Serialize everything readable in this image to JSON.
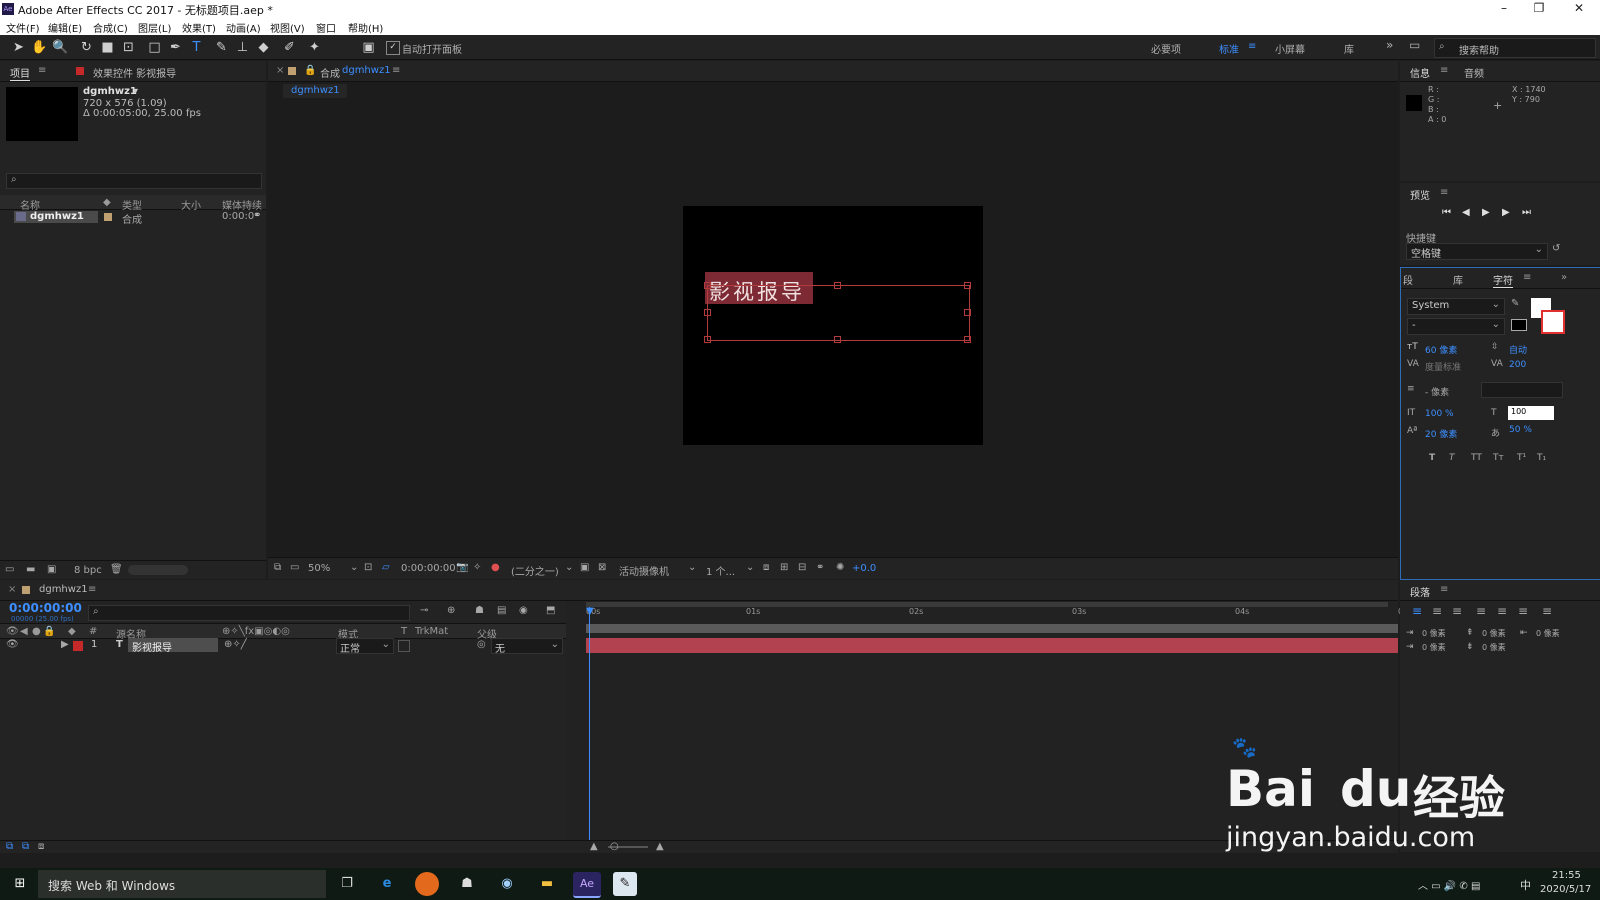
{
  "window": {
    "title": "Adobe After Effects CC 2017 - 无标题项目.aep *"
  },
  "menu": [
    "文件(F)",
    "编辑(E)",
    "合成(C)",
    "图层(L)",
    "效果(T)",
    "动画(A)",
    "视图(V)",
    "窗口",
    "帮助(H)"
  ],
  "toolbar": {
    "auto_open": "自动打开面板",
    "workspaces": [
      "必要项",
      "标准",
      "小屏幕",
      "库"
    ],
    "search_placeholder": "搜索帮助"
  },
  "project": {
    "tab": "项目",
    "effects_tab": "效果控件 影视报导",
    "item_name": "dgmhwz1",
    "item_size": "720 x 576 (1.09)",
    "item_duration": "Δ 0:00:05:00, 25.00 fps",
    "columns": [
      "名称",
      "类型",
      "大小",
      "媒体持续"
    ],
    "rows": [
      {
        "name": "dgmhwz1",
        "type": "合成",
        "duration": "0:00:0"
      }
    ],
    "bpc": "8 bpc"
  },
  "comp": {
    "tab_prefix": "合成",
    "tab_name": "dgmhwz1",
    "sub_tab": "dgmhwz1",
    "text": "影视报导",
    "footer": {
      "zoom": "50%",
      "time": "0:00:00:00",
      "resolution": "(二分之一)",
      "camera": "活动摄像机",
      "views": "1 个...",
      "exposure": "+0.0"
    }
  },
  "info": {
    "tab": "信息",
    "audio_tab": "音频",
    "r": "R :",
    "g": "G :",
    "b": "B :",
    "a": "A : 0",
    "x": "X : 1740",
    "y": "Y : 790"
  },
  "preview": {
    "tab": "预览",
    "shortcut_label": "快捷键",
    "shortcut_value": "空格键"
  },
  "character": {
    "tabs": [
      "段",
      "库",
      "字符"
    ],
    "font": "System",
    "style": "-",
    "size": "60 像素",
    "leading": "自动",
    "kerning": "度量标准",
    "tracking": "200",
    "stroke": "- 像素",
    "vscale": "100 %",
    "hscale_value": "100",
    "baseline": "20 像素",
    "tsume": "50 %",
    "styles": [
      "T",
      "T",
      "TT",
      "Tт",
      "T¹",
      "T₁"
    ]
  },
  "paragraph": {
    "tab": "段落",
    "indent": [
      "0 像素",
      "0 像素",
      "0 像素",
      "0 像素",
      "0 像素"
    ]
  },
  "timeline": {
    "tab": "dgmhwz1",
    "timecode": "0:00:00:00",
    "fps": "00000 (25.00 fps)",
    "headers": [
      "#",
      "源名称",
      "模式",
      "T",
      "TrkMat",
      "父级"
    ],
    "layer": {
      "num": "1",
      "name": "影视报导",
      "mode": "正常",
      "parent": "无"
    },
    "ticks": [
      "00s",
      "01s",
      "02s",
      "03s",
      "04s",
      "05s"
    ]
  },
  "taskbar": {
    "search": "搜索 Web 和 Windows",
    "time": "21:55",
    "date": "2020/5/17",
    "ime": "中"
  },
  "watermark": {
    "brand": "Bai",
    "brand2": "du",
    "cn": "经验",
    "url": "jingyan.baidu.com"
  }
}
